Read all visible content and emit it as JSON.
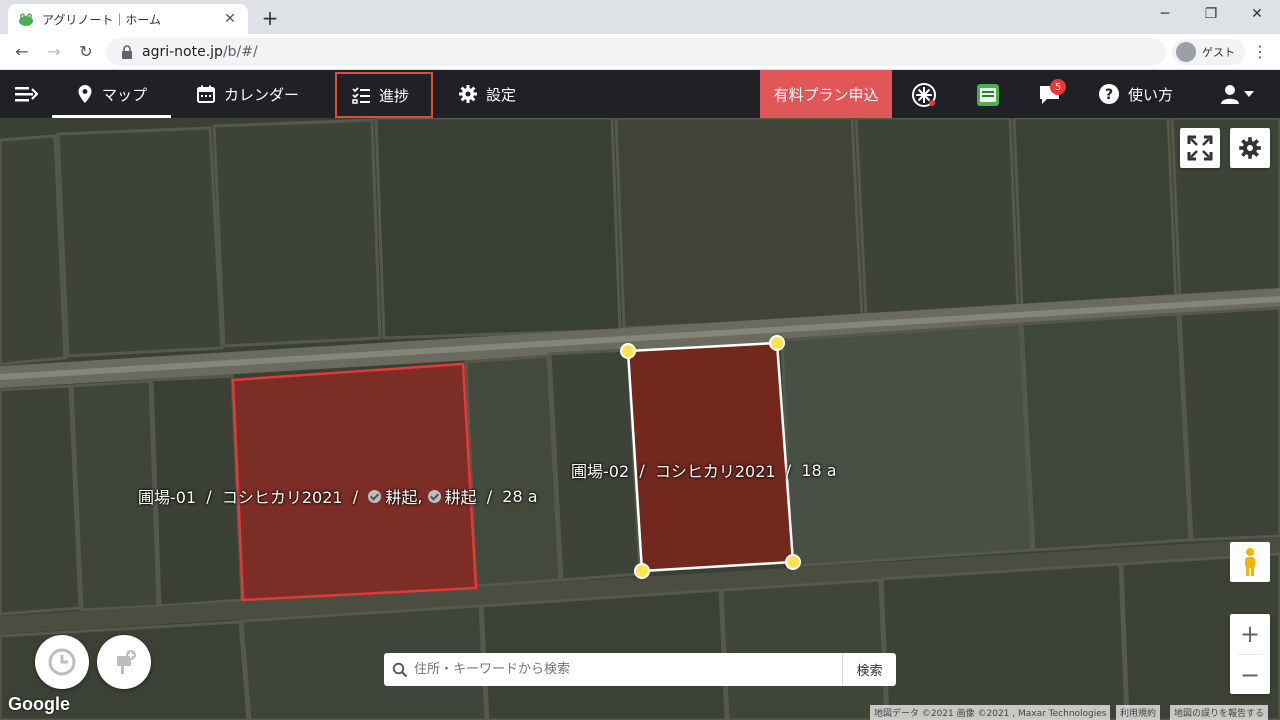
{
  "browser": {
    "tab_title": "アグリノート｜ホーム",
    "url_host": "agri-note.jp",
    "url_path": "/b/#/",
    "profile_label": "ゲスト"
  },
  "nav": {
    "map": "マップ",
    "calendar": "カレンダー",
    "progress": "進捗",
    "settings": "設定",
    "paid_plan": "有料プラン申込",
    "help": "使い方",
    "notification_count": "5"
  },
  "map": {
    "fields": [
      {
        "name": "圃場-01",
        "crop": "コシヒカリ2021",
        "tasks": [
          "耕起",
          "耕起"
        ],
        "area": "28 a"
      },
      {
        "name": "圃場-02",
        "crop": "コシヒカリ2021",
        "tasks": [],
        "area": "18 a"
      }
    ],
    "sep": "/",
    "task_sep": ",",
    "search_placeholder": "住所・キーワードから検索",
    "search_button": "検索",
    "google_logo": "Google",
    "attribution": {
      "data": "地図データ ©2021 画像 ©2021 , Maxar Technologies",
      "terms": "利用規約",
      "report": "地図の誤りを報告する"
    },
    "zoom_in": "+",
    "zoom_out": "−"
  },
  "colors": {
    "accent_red": "#e15757",
    "header_bg": "#1f2126",
    "field_fill": "#8b2a22",
    "highlight_border": "#e8492f",
    "vertex": "#ffe34d"
  }
}
